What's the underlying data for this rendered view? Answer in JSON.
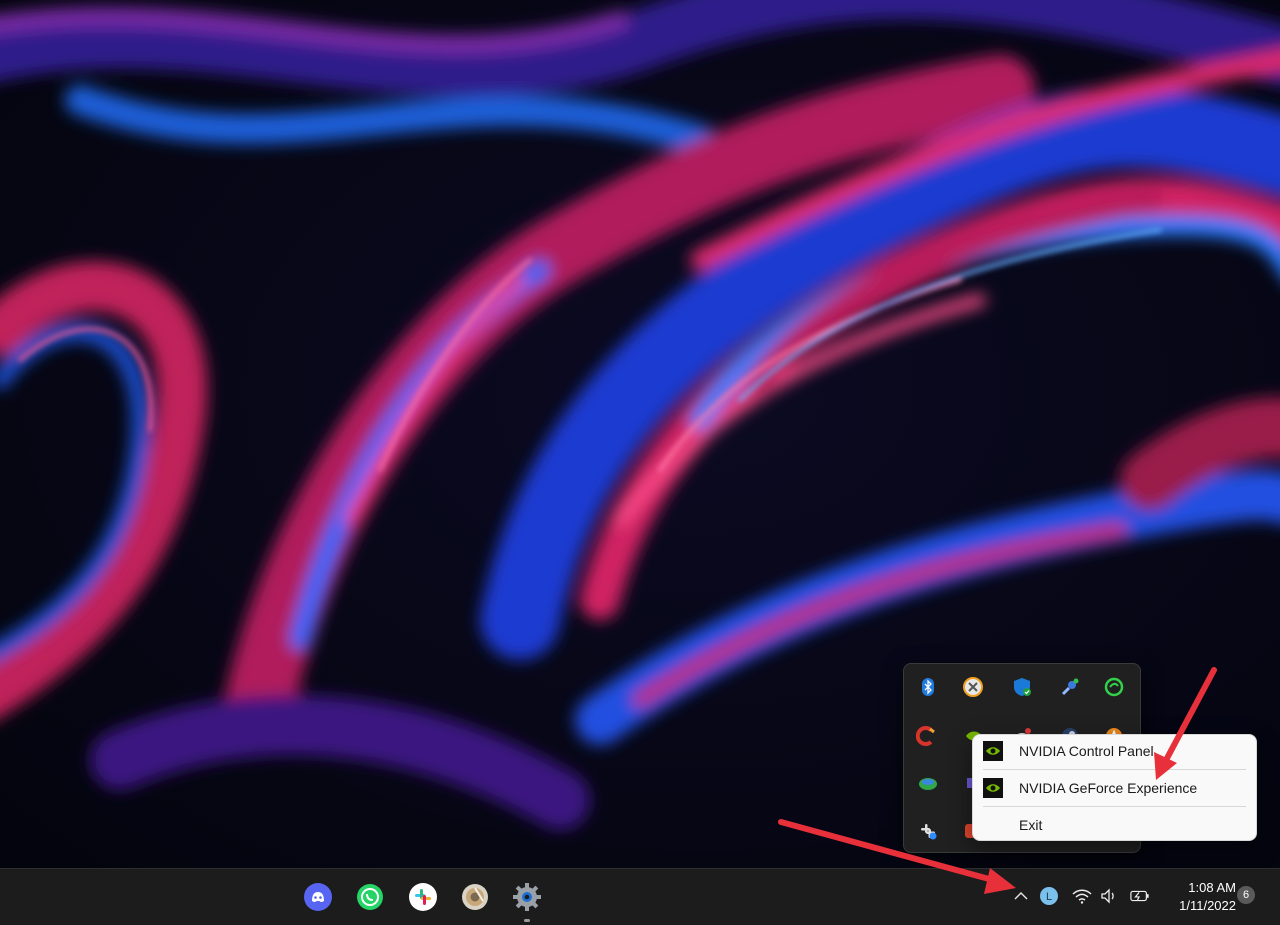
{
  "context_menu": {
    "items": [
      {
        "label": "NVIDIA Control Panel",
        "icon": "nvidia-icon"
      },
      {
        "label": "NVIDIA GeForce Experience",
        "icon": "nvidia-icon"
      },
      {
        "label": "Exit",
        "icon": ""
      }
    ]
  },
  "tray_flyout": {
    "icons": [
      "bluetooth-icon",
      "xbox-icon",
      "windows-security-icon",
      "network-tool-icon",
      "razer-icon",
      "ccleaner-icon",
      "nvidia-icon",
      "cloud-icon",
      "steam-icon",
      "vlc-icon",
      "globe-icon",
      "display-icon",
      "slack-icon",
      "antivirus-icon"
    ]
  },
  "taskbar": {
    "apps": [
      "discord-icon",
      "whatsapp-icon",
      "slack-icon",
      "chrome-canary-icon",
      "settings-icon"
    ],
    "clock": {
      "time": "1:08 AM",
      "date": "1/11/2022"
    },
    "notifications": "6",
    "system_icons": [
      "chevron-up-icon",
      "account-icon",
      "wifi-icon",
      "volume-icon",
      "battery-icon"
    ]
  },
  "colors": {
    "nvidia_green": "#76b900",
    "taskbar_bg": "#1c1c1c",
    "menu_bg": "#f9f9f9",
    "arrow_red": "#e8303a"
  }
}
